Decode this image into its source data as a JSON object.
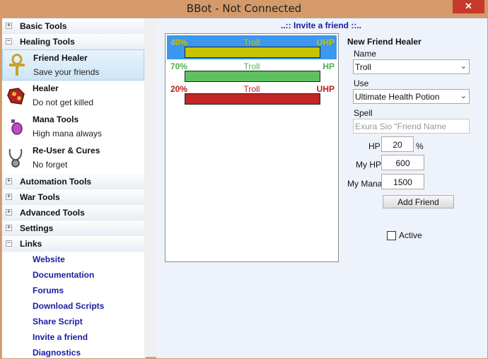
{
  "window": {
    "title": "BBot - Not Connected",
    "close_glyph": "✕"
  },
  "sidebar": {
    "top_categories": [
      {
        "label": "Basic Tools",
        "expander": "+"
      },
      {
        "label": "Healing Tools",
        "expander": "−"
      }
    ],
    "tools": [
      {
        "name": "Friend Healer",
        "desc": "Save your friends",
        "icon": "ankh-icon"
      },
      {
        "name": "Healer",
        "desc": "Do not get killed",
        "icon": "heart-potion-icon"
      },
      {
        "name": "Mana Tools",
        "desc": "High mana always",
        "icon": "mana-potion-icon"
      },
      {
        "name": "Re-User & Cures",
        "desc": "No forget",
        "icon": "amulet-icon"
      }
    ],
    "more_categories": [
      {
        "label": "Automation Tools",
        "expander": "+"
      },
      {
        "label": "War Tools",
        "expander": "+"
      },
      {
        "label": "Advanced Tools",
        "expander": "+"
      },
      {
        "label": "Settings",
        "expander": "+"
      },
      {
        "label": "Links",
        "expander": "−"
      }
    ],
    "links": [
      "Website",
      "Documentation",
      "Forums",
      "Download Scripts",
      "Share Script",
      "Invite a friend",
      "Diagnostics"
    ],
    "scroll_up": "⌃",
    "scroll_down": "⌄"
  },
  "main": {
    "header": "..:: Invite a friend ::..",
    "friends": [
      {
        "percent": "40%",
        "name": "Troll",
        "kind": "UHP",
        "pct_color": "#c9c400",
        "kind_color": "#c9c400",
        "name_color": "#c9c400",
        "bar_color": "#c8c400"
      },
      {
        "percent": "70%",
        "name": "Troll",
        "kind": "HP",
        "pct_color": "#4fb04f",
        "kind_color": "#4fb04f",
        "name_color": "#4fb04f",
        "bar_color": "#5ec05e"
      },
      {
        "percent": "20%",
        "name": "Troll",
        "kind": "UHP",
        "pct_color": "#b81c1c",
        "kind_color": "#b81c1c",
        "name_color": "#b81c1c",
        "bar_color": "#c42424"
      }
    ],
    "form": {
      "title": "New Friend Healer",
      "name_label": "Name",
      "name_value": "Troll",
      "use_label": "Use",
      "use_value": "Ultimate Health Potion",
      "spell_label": "Spell",
      "spell_placeholder": "Exura Sio \"Friend Name",
      "hp_label": "HP",
      "hp_value": "20",
      "hp_unit": "%",
      "myhp_label": "My HP",
      "myhp_value": "600",
      "mymana_label": "My Mana",
      "mymana_value": "1500",
      "add_button": "Add Friend",
      "active_label": "Active",
      "chevron": "⌄"
    }
  }
}
